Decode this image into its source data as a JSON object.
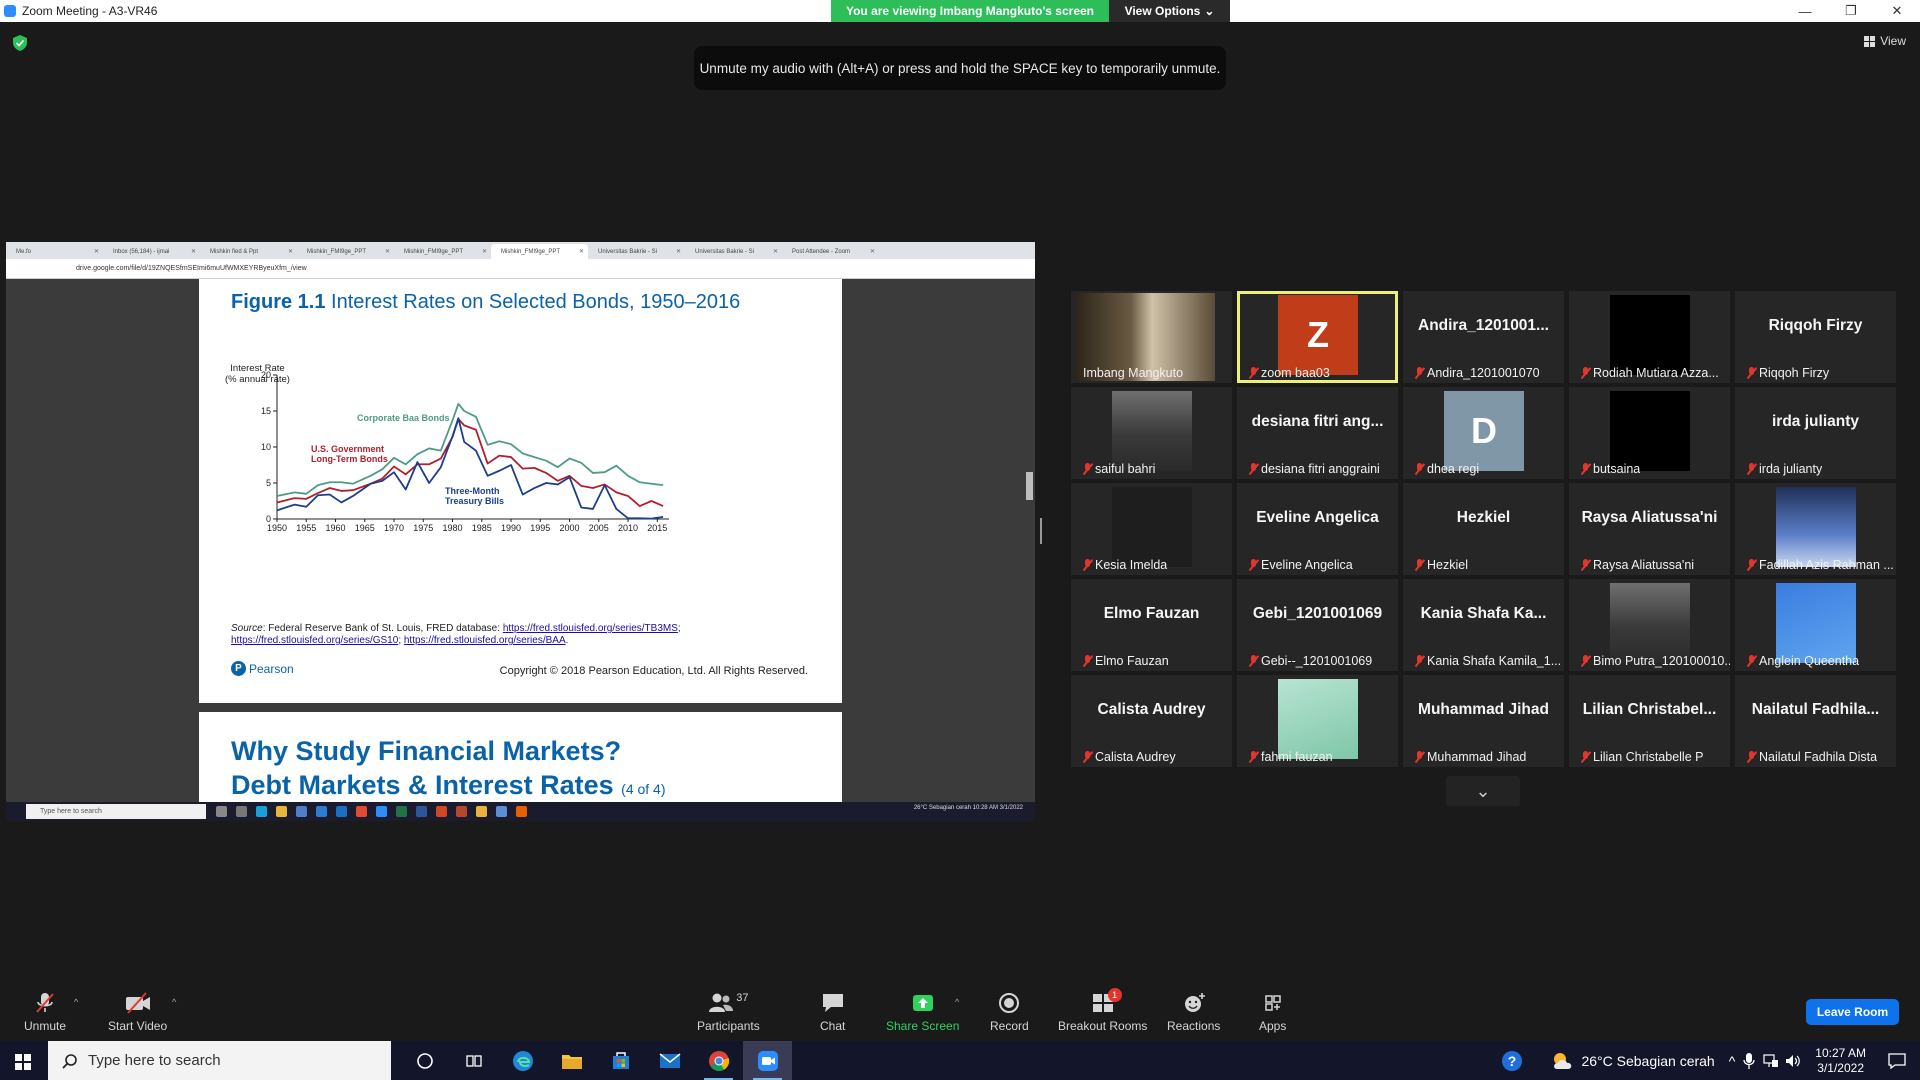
{
  "window": {
    "title": "Zoom Meeting - A3-VR46",
    "banner": "You are viewing Imbang Mangkuto's screen",
    "view_options": "View Options"
  },
  "top": {
    "unmute_tip": "Unmute my audio with (Alt+A) or press and hold the SPACE key to temporarily unmute.",
    "view_label": "View"
  },
  "shared_screen": {
    "browser_tabs": [
      "Me.fo",
      "Inbox (56,184) - ijmai",
      "Mishkin fied & Ppt",
      "Mishkin_FMI9ge_PPT",
      "Mishkin_FMI9ge_PPT",
      "Mishkin_FMI9ge_PPT",
      "Universitas Bakrie - Si",
      "Universitas Bakrie - Si",
      "Post Attendee - Zoom"
    ],
    "address": "drive.google.com/file/d/19ZNQESfmSEImi6muUfWMXEYRByeuXfm_/view",
    "slide1": {
      "figure_label": "Figure 1.1",
      "title": "Interest Rates on Selected Bonds, 1950–2016",
      "ylabel_line1": "Interest Rate",
      "ylabel_line2": "(% annual rate)",
      "source_prefix": "Source",
      "source_text": ": Federal Reserve Bank of St. Louis, FRED database: ",
      "link1": "https://fred.stlouisfed.org/series/TB3MS",
      "link2": "https://fred.stlouisfed.org/series/GS10",
      "link3": "https://fred.stlouisfed.org/series/BAA",
      "pearson": "Pearson",
      "copyright": "Copyright © 2018 Pearson Education, Ltd. All Rights Reserved."
    },
    "slide2": {
      "title_line1": "Why Study Financial Markets?",
      "title_line2": "Debt Markets & Interest Rates",
      "suffix": "(4 of 4)"
    },
    "inner_taskbar": {
      "search": "Type here to search",
      "tray": "26°C  Sebagian cerah     10:28 AM 3/1/2022"
    }
  },
  "chart_data": {
    "type": "line",
    "title": "Interest Rates on Selected Bonds, 1950–2016",
    "ylabel": "Interest Rate (% annual rate)",
    "xlim": [
      1950,
      2017
    ],
    "ylim": [
      0,
      20
    ],
    "xticks": [
      1950,
      1955,
      1960,
      1965,
      1970,
      1975,
      1980,
      1985,
      1990,
      1995,
      2000,
      2005,
      2010,
      2015
    ],
    "yticks": [
      0,
      5,
      10,
      15,
      20
    ],
    "x": [
      1950,
      1953,
      1955,
      1957,
      1959,
      1961,
      1963,
      1966,
      1968,
      1970,
      1972,
      1974,
      1976,
      1978,
      1980,
      1981,
      1982,
      1984,
      1986,
      1988,
      1990,
      1992,
      1994,
      1996,
      1998,
      2000,
      2002,
      2004,
      2006,
      2008,
      2010,
      2012,
      2014,
      2016
    ],
    "series": [
      {
        "name": "Corporate Baa Bonds",
        "color": "#4f9c86",
        "values": [
          3.2,
          3.7,
          3.5,
          4.7,
          5.1,
          5.1,
          4.9,
          6.0,
          6.9,
          8.5,
          7.6,
          9.0,
          9.8,
          9.5,
          13.7,
          16.0,
          15.0,
          14.2,
          10.3,
          10.8,
          10.4,
          9.1,
          8.6,
          8.1,
          7.2,
          8.4,
          7.8,
          6.4,
          6.5,
          7.4,
          6.0,
          5.1,
          4.9,
          4.7
        ]
      },
      {
        "name": "U.S. Government Long-Term Bonds",
        "color": "#b0202e",
        "values": [
          2.3,
          2.9,
          2.8,
          3.6,
          4.3,
          3.9,
          4.0,
          4.9,
          5.6,
          7.3,
          6.2,
          7.6,
          7.6,
          8.4,
          11.4,
          13.9,
          13.0,
          12.4,
          7.7,
          8.8,
          8.6,
          7.0,
          7.1,
          6.4,
          5.3,
          6.0,
          4.6,
          4.3,
          4.8,
          3.7,
          3.2,
          1.8,
          2.5,
          1.8
        ]
      },
      {
        "name": "Three-Month Treasury Bills",
        "color": "#1c3f8c",
        "values": [
          1.2,
          2.0,
          1.7,
          3.3,
          3.4,
          2.3,
          3.2,
          4.9,
          5.3,
          6.5,
          4.1,
          7.9,
          5.0,
          7.2,
          11.5,
          14.0,
          10.7,
          9.5,
          6.0,
          6.7,
          7.5,
          3.4,
          4.3,
          5.0,
          4.8,
          5.8,
          1.6,
          1.4,
          4.7,
          1.4,
          0.1,
          0.1,
          0.05,
          0.3
        ]
      }
    ]
  },
  "participants": [
    {
      "name": "Imbang Mangkuto",
      "display": "",
      "kind": "video",
      "muted": false,
      "active": false
    },
    {
      "name": "zoom baa03",
      "display": "Z",
      "kind": "letter",
      "color": "#c13c19",
      "muted": true,
      "active": true
    },
    {
      "name": "Andira_1201001070",
      "display": "Andira_1201001...",
      "kind": "text",
      "muted": true
    },
    {
      "name": "Rodiah Mutiara Azza...",
      "display": "",
      "kind": "black",
      "muted": true
    },
    {
      "name": "Riqqoh Firzy",
      "display": "Riqqoh Firzy",
      "kind": "text",
      "muted": true
    },
    {
      "name": "saiful bahri",
      "display": "",
      "kind": "video",
      "muted": true
    },
    {
      "name": "desiana fitri anggraini",
      "display": "desiana fitri ang...",
      "kind": "text",
      "muted": true
    },
    {
      "name": "dhea regi",
      "display": "D",
      "kind": "letter",
      "color": "#7f97a6",
      "muted": true
    },
    {
      "name": "butsaina",
      "display": "",
      "kind": "black",
      "muted": true
    },
    {
      "name": "irda julianty",
      "display": "irda julianty",
      "kind": "text",
      "muted": true
    },
    {
      "name": "Kesia Imelda",
      "display": "",
      "kind": "dark",
      "muted": true
    },
    {
      "name": "Eveline Angelica",
      "display": "Eveline Angelica",
      "kind": "text",
      "muted": true
    },
    {
      "name": "Hezkiel",
      "display": "Hezkiel",
      "kind": "text",
      "muted": true
    },
    {
      "name": "Raysa Aliatussa'ni",
      "display": "Raysa Aliatussa'ni",
      "kind": "text",
      "muted": true
    },
    {
      "name": "Fadillah Azis Rahman ...",
      "display": "",
      "kind": "sky",
      "muted": true
    },
    {
      "name": "Elmo Fauzan",
      "display": "Elmo Fauzan",
      "kind": "text",
      "muted": true
    },
    {
      "name": "Gebi--_1201001069",
      "display": "Gebi_1201001069",
      "kind": "text",
      "muted": true
    },
    {
      "name": "Kania Shafa Kamila_1...",
      "display": "Kania Shafa Ka...",
      "kind": "text",
      "muted": true
    },
    {
      "name": "Bimo Putra_120100010...",
      "display": "",
      "kind": "video",
      "muted": true
    },
    {
      "name": "Anglein Queentha",
      "display": "",
      "kind": "blue",
      "muted": true
    },
    {
      "name": "Calista Audrey",
      "display": "Calista Audrey",
      "kind": "text",
      "muted": true
    },
    {
      "name": "fahmi fauzan",
      "display": "",
      "kind": "mint",
      "muted": true
    },
    {
      "name": "Muhammad Jihad",
      "display": "Muhammad Jihad",
      "kind": "text",
      "muted": true
    },
    {
      "name": "Lilian Christabelle P",
      "display": "Lilian Christabel...",
      "kind": "text",
      "muted": true
    },
    {
      "name": "Nailatul Fadhila Dista",
      "display": "Nailatul Fadhila...",
      "kind": "text",
      "muted": true
    }
  ],
  "toolbar": {
    "unmute": "Unmute",
    "start_video": "Start Video",
    "participants": "Participants",
    "participants_count": "37",
    "chat": "Chat",
    "share_screen": "Share Screen",
    "record": "Record",
    "breakout_rooms": "Breakout Rooms",
    "breakout_badge": "1",
    "reactions": "Reactions",
    "apps": "Apps",
    "leave": "Leave Room"
  },
  "taskbar": {
    "search_placeholder": "Type here to search",
    "weather": "26°C  Sebagian cerah",
    "time": "10:27 AM",
    "date": "3/1/2022"
  }
}
